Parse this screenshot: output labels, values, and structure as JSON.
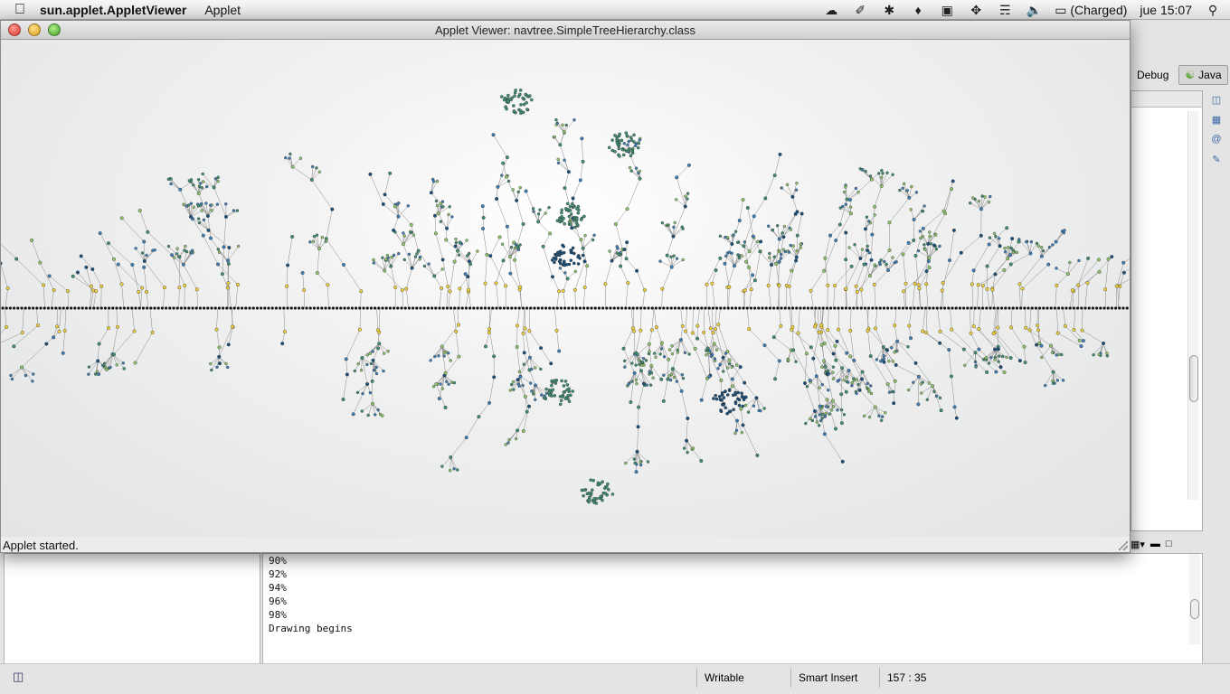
{
  "menubar": {
    "app_name": "sun.applet.AppletViewer",
    "menu": "Applet",
    "battery": "(Charged)",
    "clock": "jue 15:07"
  },
  "applet_window": {
    "title": "Applet Viewer: navtree.SimpleTreeHierarchy.class",
    "status": "Applet started."
  },
  "ide": {
    "perspectives": [
      {
        "label": "Debug",
        "icon": "debug-perspective-icon"
      },
      {
        "label": "Java",
        "icon": "java-perspective-icon"
      }
    ],
    "console_lines": [
      "90%",
      "92%",
      "94%",
      "96%",
      "98%",
      "Drawing begins"
    ],
    "status": {
      "writable": "Writable",
      "insert_mode": "Smart Insert",
      "position": "157 : 35"
    }
  },
  "graph": {
    "type": "radial tree hierarchy",
    "node_colors": [
      "#f2d23a",
      "#8fc56a",
      "#3f8f70",
      "#3c7fb8",
      "#1a4f7a",
      "#111111"
    ],
    "edge_color": "#8a8a8a"
  }
}
